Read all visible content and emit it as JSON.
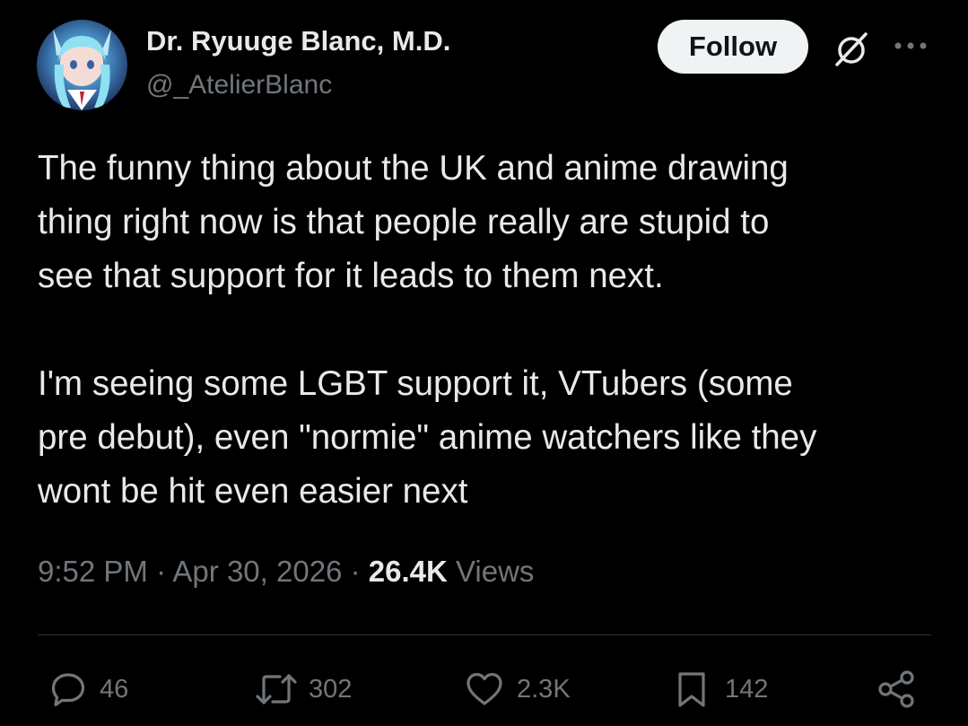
{
  "author": {
    "display_name": "Dr. Ryuuge Blanc, M.D.",
    "handle": "@_AtelierBlanc"
  },
  "header": {
    "follow_label": "Follow",
    "grok_icon": "grok-slash-icon",
    "more_icon": "more-dots-icon"
  },
  "tweet": {
    "paragraph1": [
      "The funny thing about the UK and anime drawing",
      "thing right now is that people really are stupid to",
      "see that support for it leads to them next."
    ],
    "paragraph2": [
      "I'm seeing some LGBT support it, VTubers (some",
      "pre debut), even \"normie\" anime watchers like they",
      "wont be hit even easier next"
    ]
  },
  "meta": {
    "time": "9:52 PM",
    "sep1": " · ",
    "date": "Apr 30, 2026",
    "sep2": " · ",
    "views_count": "26.4K",
    "views_label": " Views"
  },
  "actions": {
    "replies": "46",
    "reposts": "302",
    "likes": "2.3K",
    "bookmarks": "142"
  },
  "colors": {
    "background": "#000000",
    "text": "#e7e9ea",
    "secondary": "#71767b",
    "divider": "#2f3336",
    "follow_bg": "#eff3f4"
  }
}
